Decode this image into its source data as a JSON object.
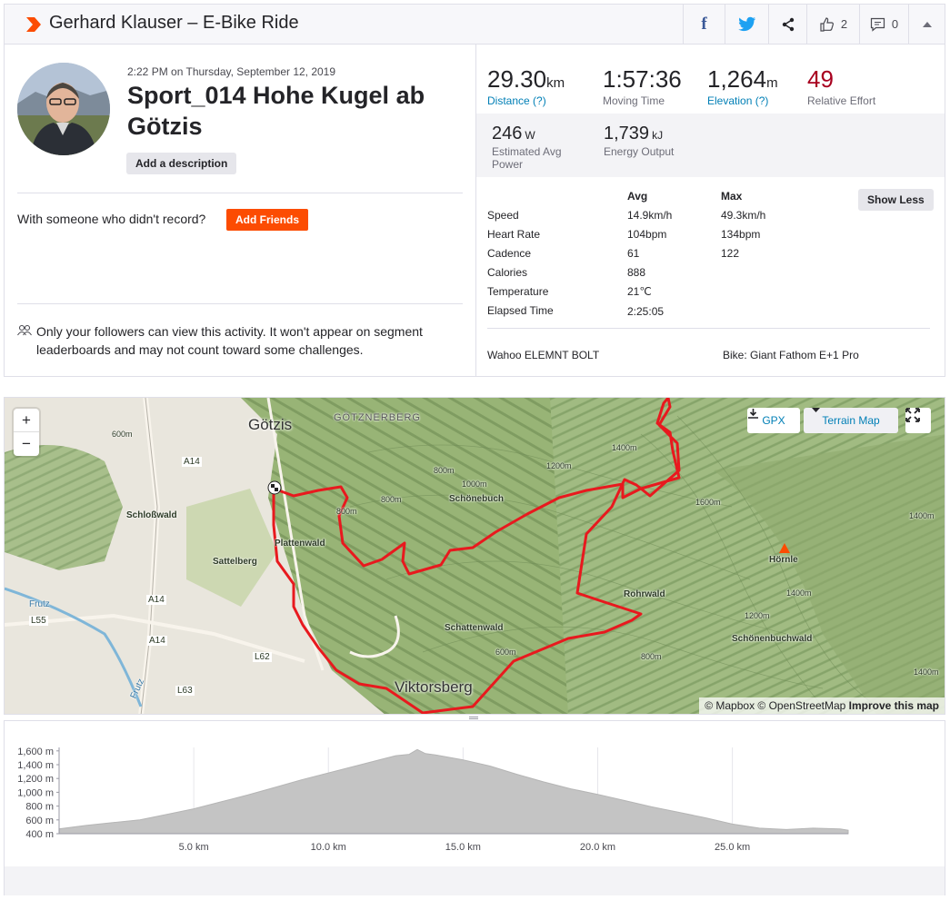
{
  "header": {
    "title": "Gerhard Klauser – E-Bike Ride",
    "kudos_count": "2",
    "comment_count": "0"
  },
  "activity": {
    "time": "2:22 PM on Thursday, September 12, 2019",
    "name": "Sport_014 Hohe Kugel ab Götzis",
    "add_description": "Add a description",
    "with_someone": "With someone who didn't record?",
    "add_friends": "Add Friends",
    "privacy": "Only your followers can view this activity. It won't appear on segment leaderboards and may not count toward some challenges."
  },
  "stats": {
    "distance": {
      "value": "29.30",
      "unit": "km",
      "label": "Distance (?)"
    },
    "moving_time": {
      "value": "1:57:36",
      "label": "Moving Time"
    },
    "elevation": {
      "value": "1,264",
      "unit": "m",
      "label": "Elevation (?)"
    },
    "relative_effort": {
      "value": "49",
      "label": "Relative Effort"
    },
    "power": {
      "value": "246",
      "unit": "W",
      "label": "Estimated Avg Power"
    },
    "energy": {
      "value": "1,739",
      "unit": "kJ",
      "label": "Energy Output"
    }
  },
  "table": {
    "col_avg": "Avg",
    "col_max": "Max",
    "show_less": "Show Less",
    "rows": [
      {
        "label": "Speed",
        "avg": "14.9km/h",
        "max": "49.3km/h"
      },
      {
        "label": "Heart Rate",
        "avg": "104bpm",
        "max": "134bpm"
      },
      {
        "label": "Cadence",
        "avg": "61",
        "max": "122"
      },
      {
        "label": "Calories",
        "avg": "888",
        "max": ""
      },
      {
        "label": "Temperature",
        "avg": "21℃",
        "max": ""
      },
      {
        "label": "Elapsed Time",
        "avg": "2:25:05",
        "max": ""
      }
    ],
    "device": "Wahoo ELEMNT BOLT",
    "bike": "Bike: Giant Fathom E+1 Pro"
  },
  "map": {
    "zoom_in": "+",
    "zoom_out": "−",
    "gpx": "GPX",
    "map_type": "Terrain Map",
    "attribution_a": "© Mapbox © OpenStreetMap",
    "attribution_b": "Improve this map",
    "places": {
      "gotzis": "Götzis",
      "gotznerberg": "GÖTZNERBERG",
      "schonebuch": "Schönebuch",
      "schlosswald": "Schloßwald",
      "plattenwald": "Plattenwald",
      "sattelberg": "Sattelberg",
      "hornle": "Hörnle",
      "rohrwald": "Rohrwald",
      "schattenwald": "Schattenwald",
      "schonenbuchwald": "Schönenbuchwald",
      "viktorsberg": "Viktorsberg"
    },
    "roads": {
      "a14_top": "A14",
      "a14_mid": "A14",
      "a14_low": "A14",
      "l55": "L55",
      "l62": "L62",
      "l63": "L63",
      "frutz": "Frutz",
      "frutz2": "Frutz"
    },
    "contours": [
      "600m",
      "800m",
      "800m",
      "1000m",
      "1200m",
      "1400m",
      "1600m",
      "800m",
      "1400m",
      "1200m",
      "800m",
      "600m",
      "1400m",
      "1400m"
    ]
  },
  "accent_color": "#fc4c02",
  "route_color": "#e8191e",
  "chart_data": {
    "type": "area",
    "xlabel": "",
    "ylabel": "",
    "y_ticks": [
      "1,600 m",
      "1,400 m",
      "1,200 m",
      "1,000 m",
      "800 m",
      "600 m",
      "400 m"
    ],
    "x_ticks": [
      "5.0 km",
      "10.0 km",
      "15.0 km",
      "20.0 km",
      "25.0 km"
    ],
    "xlim": [
      0,
      29.3
    ],
    "ylim": [
      400,
      1650
    ],
    "x": [
      0,
      1,
      2,
      3,
      4,
      5,
      6,
      7,
      8,
      9,
      10,
      11,
      12,
      12.5,
      13,
      13.3,
      13.6,
      14,
      15,
      16,
      17,
      18,
      19,
      20,
      21,
      22,
      23,
      24,
      25,
      26,
      27,
      28,
      29,
      29.3
    ],
    "values": [
      470,
      520,
      560,
      600,
      680,
      760,
      860,
      960,
      1070,
      1180,
      1280,
      1380,
      1480,
      1530,
      1550,
      1620,
      1560,
      1540,
      1470,
      1380,
      1260,
      1150,
      1050,
      970,
      880,
      790,
      710,
      630,
      540,
      480,
      460,
      480,
      470,
      450
    ]
  }
}
